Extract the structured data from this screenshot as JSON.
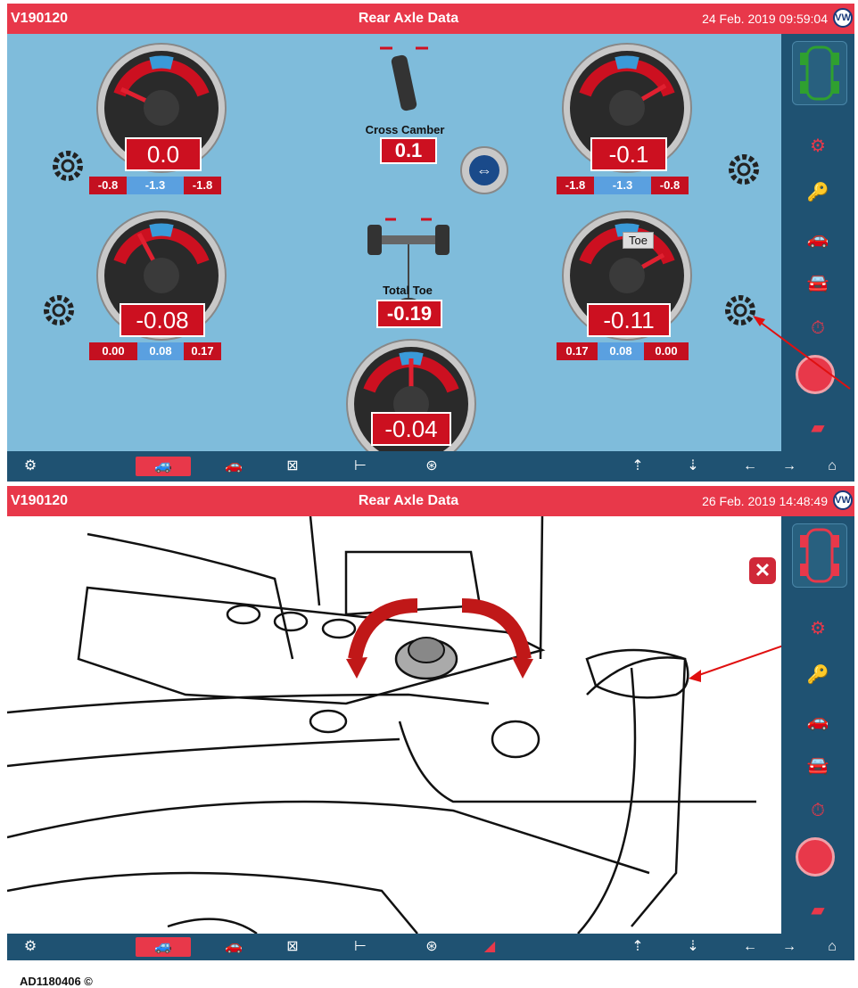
{
  "screen1": {
    "header": {
      "code": "V190120",
      "title": "Rear Axle Data",
      "datetime": "24 Feb. 2019 09:59:04"
    },
    "gauges": {
      "top_left": {
        "value": "0.0",
        "range": [
          "-0.8",
          "-1.3",
          "-1.8"
        ]
      },
      "top_right": {
        "value": "-0.1",
        "range": [
          "-1.8",
          "-1.3",
          "-0.8"
        ]
      },
      "bottom_left": {
        "value": "-0.08",
        "range": [
          "0.00",
          "0.08",
          "0.17"
        ]
      },
      "bottom_right": {
        "value": "-0.11",
        "tag": "Toe",
        "range": [
          "0.17",
          "0.08",
          "0.00"
        ]
      },
      "bottom_center": {
        "value": "-0.04"
      }
    },
    "cross_camber": {
      "label": "Cross Camber",
      "value": "0.1"
    },
    "total_toe": {
      "label": "Total Toe",
      "value": "-0.19"
    }
  },
  "screen2": {
    "header": {
      "code": "V190120",
      "title": "Rear Axle Data",
      "datetime": "26 Feb. 2019 14:48:49"
    },
    "caption": "AD1180406 ©"
  },
  "colors": {
    "title_bar": "#e8384a",
    "panel_bg": "#7fbcdb",
    "nav_bg": "#1f5272",
    "accent_red": "#cc1020",
    "accent_blue": "#5aa0e0"
  },
  "icons": {
    "sidebar": [
      "car-top-view-icon",
      "rear-axle-icon",
      "key-car-icon",
      "car-lift-icon",
      "car-front-icon",
      "wheel-clock-icon",
      "axle-lift-button-icon",
      "printer-icon"
    ],
    "bottom_bar": [
      "settings-icon",
      "car-side-icon",
      "car-outline-icon",
      "alignment-icon",
      "axle-icon",
      "steering-wheel-icon",
      "lift-up-icon",
      "lift-icon",
      "arrow-left-icon",
      "arrow-right-icon",
      "home-icon"
    ]
  }
}
